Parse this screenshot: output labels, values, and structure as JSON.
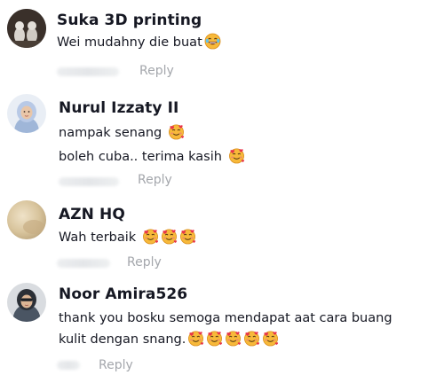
{
  "reply_label": "Reply",
  "comments": [
    {
      "name": "Suka 3D printing",
      "lines": [
        "Wei mudahny die buat"
      ],
      "line_emojis": [
        [
          "laughing-tears-emoji"
        ]
      ],
      "avatar": "figurines"
    },
    {
      "name": "Nurul Izzaty II",
      "lines": [
        "nampak senang ",
        "boleh cuba.. terima kasih "
      ],
      "line_emojis": [
        [
          "smiling-face-with-hearts-emoji"
        ],
        [
          "smiling-face-with-hearts-emoji"
        ]
      ],
      "avatar": "hijab-woman"
    },
    {
      "name": "AZN HQ",
      "lines": [
        "Wah terbaik "
      ],
      "line_emojis": [
        [
          "smiling-face-with-hearts-emoji",
          "smiling-face-with-hearts-emoji",
          "smiling-face-with-hearts-emoji"
        ]
      ],
      "avatar": "beige-blur"
    },
    {
      "name": "Noor Amira526",
      "lines": [
        "thank you bosku semoga mendapat aat cara buang",
        "kulit dengan snang."
      ],
      "line_emojis": [
        [],
        [
          "smiling-face-with-hearts-emoji",
          "smiling-face-with-hearts-emoji",
          "smiling-face-with-hearts-emoji",
          "smiling-face-with-hearts-emoji",
          "smiling-face-with-hearts-emoji"
        ]
      ],
      "avatar": "dark-hijab-woman"
    }
  ],
  "colors": {
    "text": "#161823",
    "reply": "#a4a7ac",
    "emoji_face": "#f7b93a",
    "emoji_heart": "#e8344a"
  }
}
